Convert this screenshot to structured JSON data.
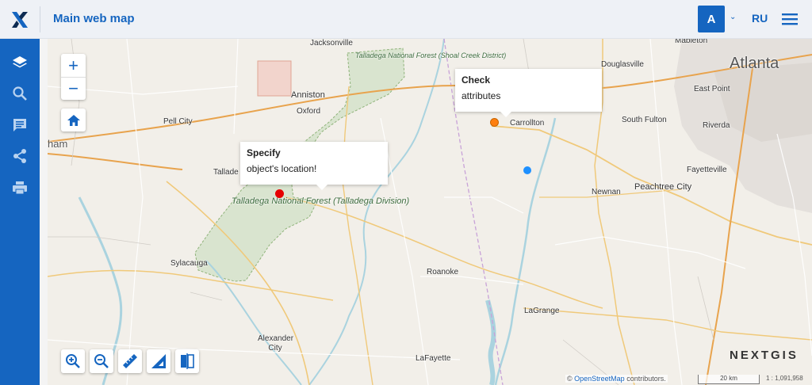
{
  "header": {
    "title": "Main web map",
    "avatar_letter": "A",
    "language": "RU"
  },
  "sidebar": {
    "items": [
      {
        "icon": "layers-icon"
      },
      {
        "icon": "search-icon"
      },
      {
        "icon": "message-icon"
      },
      {
        "icon": "share-icon"
      },
      {
        "icon": "print-icon"
      }
    ]
  },
  "map": {
    "labels": {
      "jacksonville": "Jacksonville",
      "mableton": "Mableton",
      "douglasville": "Douglasville",
      "atlanta": "Atlanta",
      "anniston": "Anniston",
      "oxford": "Oxford",
      "east_point": "East Point",
      "pell_city": "Pell City",
      "carrollton": "Carrollton",
      "south_fulton": "South Fulton",
      "riverdale": "Riverda",
      "birmingham": "ham",
      "talladega": "Tallade",
      "fayetteville": "Fayetteville",
      "newnan": "Newnan",
      "peachtree_city": "Peachtree City",
      "sylacauga": "Sylacauga",
      "roanoke": "Roanoke",
      "lagrange": "LaGrange",
      "alexander_city": "Alexander City",
      "lafayette": "LaFayette",
      "forest_shoal": "Talladega National Forest (Shoal Creek District)",
      "forest_talladega": "Talladega National Forest (Talladega Division)"
    },
    "popups": [
      {
        "title": "Check",
        "text": "attributes"
      },
      {
        "title": "Specify",
        "text": "object's location!"
      }
    ],
    "markers": [
      {
        "color": "#ff7f0e"
      },
      {
        "color": "#1e90ff"
      },
      {
        "color": "#e60000"
      }
    ],
    "brand": "NEXTGIS",
    "attribution_prefix": "©",
    "attribution_link": "OpenStreetMap",
    "attribution_suffix": "contributors.",
    "scale_label": "20 km",
    "scale_ratio": "1 : 1,091,958"
  },
  "colors": {
    "accent": "#1565c0",
    "forest": "#d9e4cf",
    "water": "#aad3df"
  }
}
